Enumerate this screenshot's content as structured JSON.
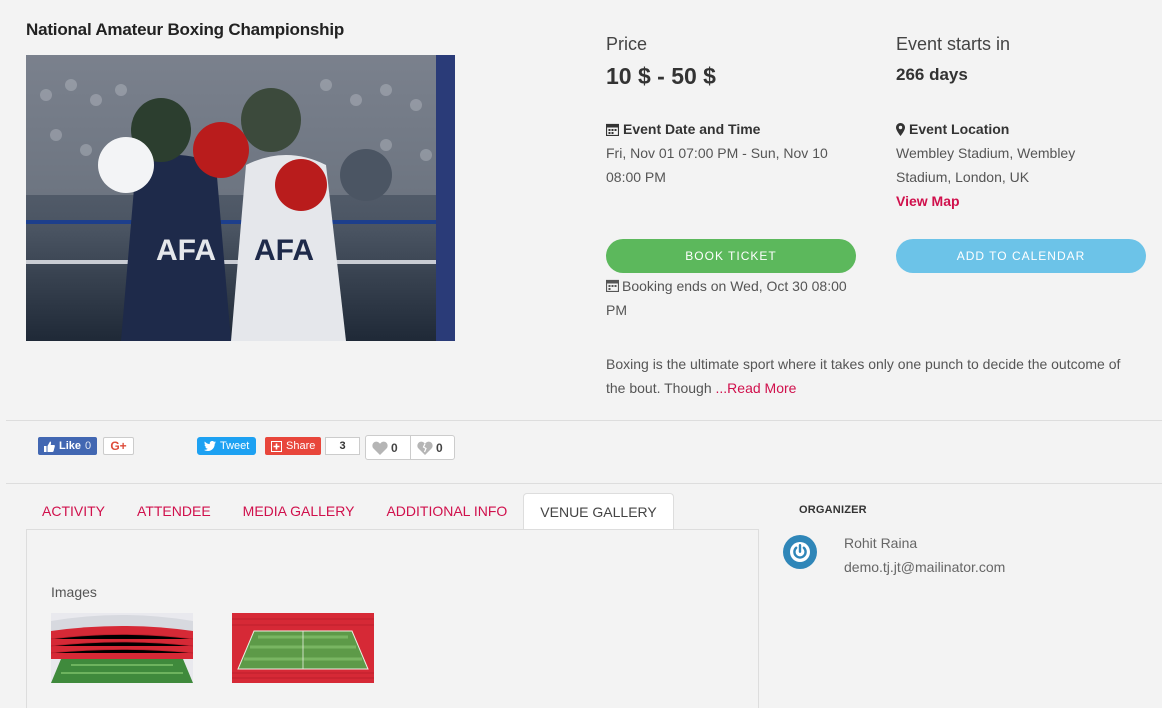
{
  "event": {
    "title": "National Amateur Boxing Championship",
    "image_alt": "Two amateur boxers exchanging punches in the ring"
  },
  "price": {
    "label": "Price",
    "value": "10 $ - 50 $"
  },
  "countdown": {
    "label": "Event starts in",
    "value": "266 days"
  },
  "date_time": {
    "icon": "calendar-icon",
    "label": "Event Date and Time",
    "value": "Fri, Nov 01 07:00 PM - Sun, Nov 10 08:00 PM"
  },
  "location": {
    "icon": "map-marker-icon",
    "label": "Event Location",
    "value": "Wembley Stadium, Wembley Stadium, London, UK",
    "map_link": "View Map"
  },
  "actions": {
    "book_ticket": "BOOK TICKET",
    "add_to_calendar": "ADD TO CALENDAR",
    "booking_ends": "Booking ends on Wed, Oct 30 08:00 PM"
  },
  "description": {
    "text": "Boxing is the ultimate sport where it takes only one punch to decide the outcome of the bout. Though ",
    "read_more": "...Read More"
  },
  "social": {
    "fb_like": "Like",
    "fb_count": "0",
    "gplus": "G+",
    "tweet": "Tweet",
    "share": "Share",
    "share_count": "3",
    "likes": "0",
    "dislikes": "0"
  },
  "tabs": [
    {
      "label": "ACTIVITY"
    },
    {
      "label": "ATTENDEE"
    },
    {
      "label": "MEDIA GALLERY"
    },
    {
      "label": "ADDITIONAL INFO"
    },
    {
      "label": "VENUE GALLERY"
    }
  ],
  "active_tab": "VENUE GALLERY",
  "venue_gallery": {
    "images_label": "Images"
  },
  "organizer": {
    "heading": "ORGANIZER",
    "name": "Rohit Raina",
    "email": "demo.tj.jt@mailinator.com"
  },
  "colors": {
    "accent": "#d0104c",
    "book_button": "#5cb85c",
    "calendar_button": "#6cc3e8",
    "facebook": "#4267b2",
    "twitter": "#1da1f2"
  }
}
